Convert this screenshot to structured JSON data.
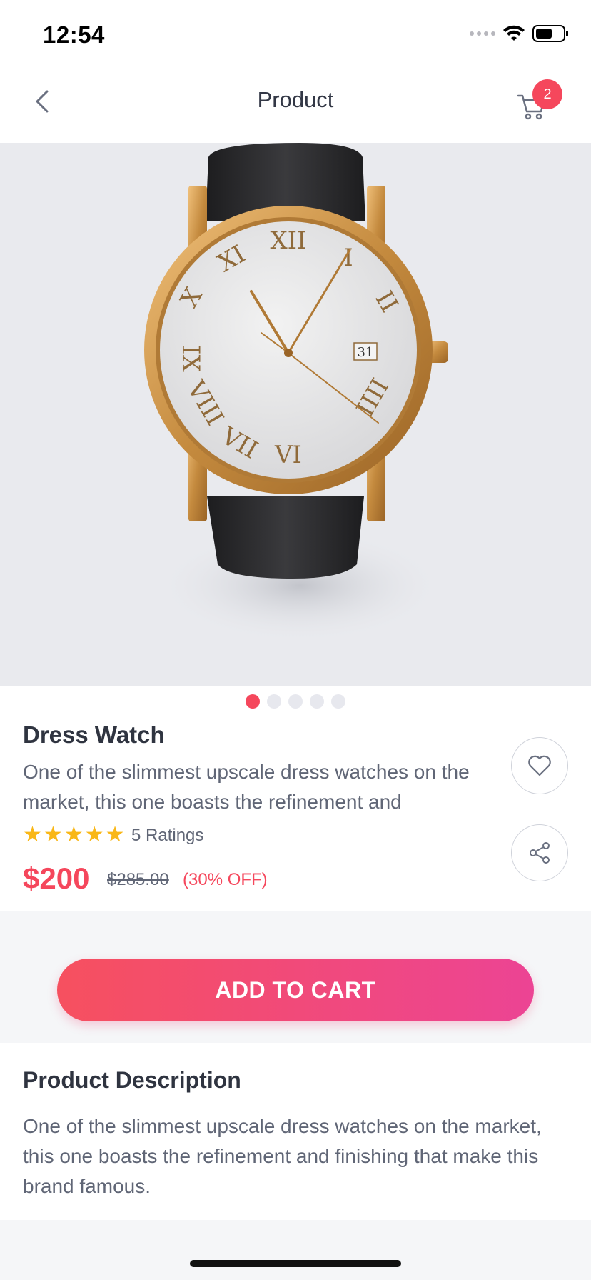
{
  "status_bar": {
    "time": "12:54"
  },
  "header": {
    "title": "Product",
    "cart_count": "2"
  },
  "carousel": {
    "total": 5,
    "active_index": 0
  },
  "product": {
    "name": "Dress Watch",
    "short_description": "One of the slimmest upscale dress watches on the market, this one boasts the refinement and",
    "rating_stars": 5,
    "ratings_label": "5 Ratings",
    "price": "$200",
    "original_price": "$285.00",
    "discount": "(30% OFF)"
  },
  "actions": {
    "add_to_cart": "ADD TO CART"
  },
  "description": {
    "title": "Product Description",
    "text": "One of the slimmest upscale dress watches on the market, this one boasts the refinement and finishing that make this brand famous."
  },
  "colors": {
    "accent": "#f5475c",
    "gradient_end": "#ec4494",
    "star": "#f9b717"
  }
}
